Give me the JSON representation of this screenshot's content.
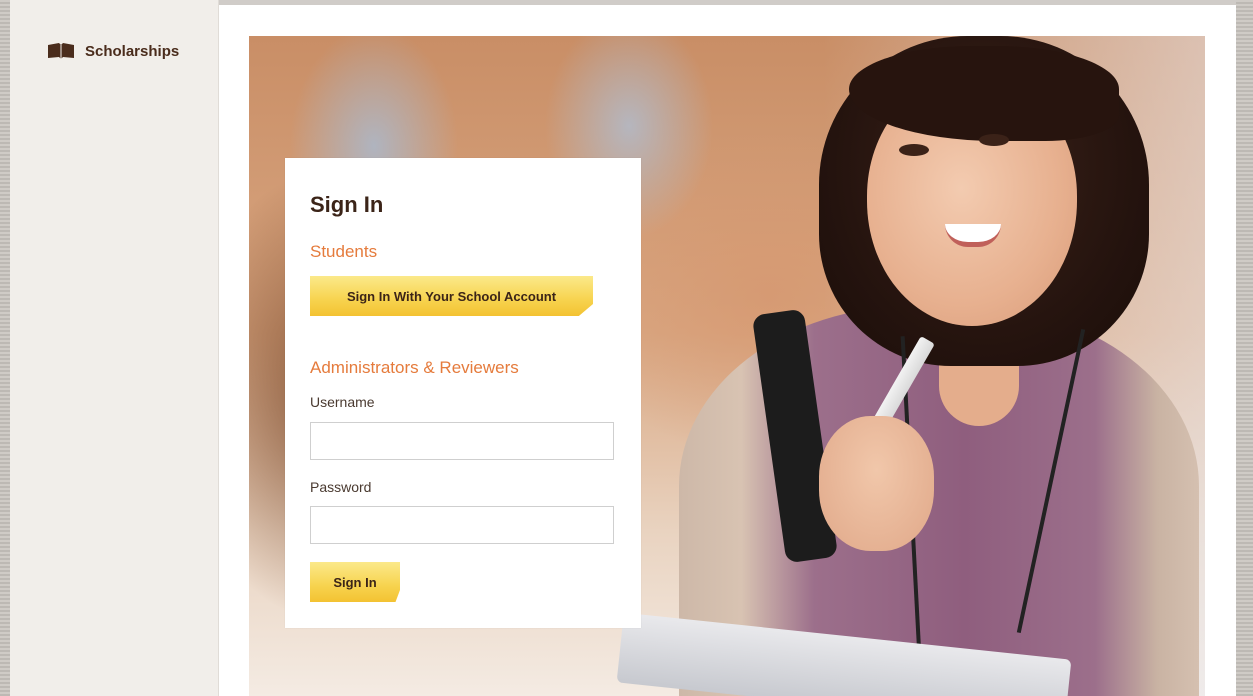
{
  "app": {
    "brand_label": "Scholarships",
    "brand_icon": "open-book-icon"
  },
  "signin": {
    "title": "Sign In",
    "students_heading": "Students",
    "school_account_button": "Sign In With Your School Account",
    "admins_heading": "Administrators & Reviewers",
    "username_label": "Username",
    "username_value": "",
    "password_label": "Password",
    "password_value": "",
    "submit_button": "Sign In"
  },
  "colors": {
    "accent_orange": "#e57b3c",
    "button_yellow": "#f7d34e",
    "brand_brown": "#4a2c1c"
  }
}
